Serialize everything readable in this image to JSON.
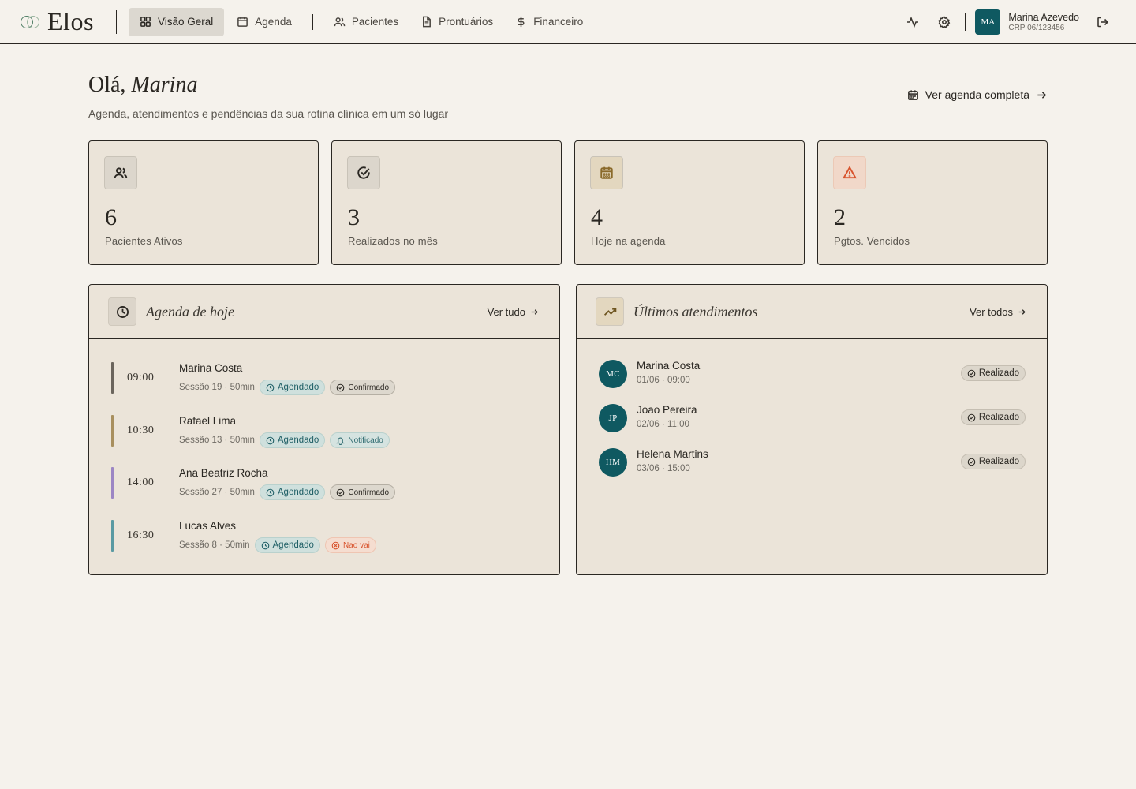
{
  "app": {
    "name": "Elos"
  },
  "nav": {
    "items": [
      {
        "label": "Visão Geral",
        "icon": "grid-icon",
        "active": true
      },
      {
        "label": "Agenda",
        "icon": "calendar-icon",
        "active": false
      },
      {
        "label": "Pacientes",
        "icon": "users-icon",
        "active": false
      },
      {
        "label": "Prontuários",
        "icon": "file-icon",
        "active": false
      },
      {
        "label": "Financeiro",
        "icon": "dollar-icon",
        "active": false
      }
    ]
  },
  "user": {
    "initials": "MA",
    "name": "Marina Azevedo",
    "crp": "CRP 06/123456"
  },
  "header": {
    "greeting_prefix": "Olá,",
    "greeting_name": "Marina",
    "subtitle": "Agenda, atendimentos e pendências da sua rotina clínica em um só lugar",
    "agenda_link": "Ver agenda completa"
  },
  "stats": [
    {
      "value": "6",
      "label": "Pacientes Ativos",
      "icon": "users-icon"
    },
    {
      "value": "3",
      "label": "Realizados no mês",
      "icon": "check-circle-icon"
    },
    {
      "value": "4",
      "label": "Hoje na agenda",
      "icon": "calendar-icon"
    },
    {
      "value": "2",
      "label": "Pgtos. Vencidos",
      "icon": "alert-triangle-icon"
    }
  ],
  "agenda_today": {
    "title": "Agenda de hoje",
    "link": "Ver tudo",
    "appointments": [
      {
        "time": "09:00",
        "name": "Marina Costa",
        "meta": "Sessão 19 · 50min",
        "status": "Agendado",
        "extra": "Confirmado",
        "color": "#6b655d"
      },
      {
        "time": "10:30",
        "name": "Rafael Lima",
        "meta": "Sessão 13 · 50min",
        "status": "Agendado",
        "extra": "Notificado",
        "color": "#a88f5e"
      },
      {
        "time": "14:00",
        "name": "Ana Beatriz Rocha",
        "meta": "Sessão 27 · 50min",
        "status": "Agendado",
        "extra": "Confirmado",
        "color": "#9c86c4"
      },
      {
        "time": "16:30",
        "name": "Lucas Alves",
        "meta": "Sessão 8 · 50min",
        "status": "Agendado",
        "extra": "Nao vai",
        "color": "#5a9aa3"
      }
    ]
  },
  "recent": {
    "title": "Últimos atendimentos",
    "link": "Ver todos",
    "items": [
      {
        "initials": "MC",
        "name": "Marina Costa",
        "date": "01/06 · 09:00",
        "status": "Realizado"
      },
      {
        "initials": "JP",
        "name": "Joao Pereira",
        "date": "02/06 · 11:00",
        "status": "Realizado"
      },
      {
        "initials": "HM",
        "name": "Helena Martins",
        "date": "03/06 · 15:00",
        "status": "Realizado"
      }
    ]
  },
  "colors": {
    "accent": "#0f5961",
    "background": "#f5f2ec",
    "card": "#ebe4d9",
    "warning": "#d8532d"
  }
}
